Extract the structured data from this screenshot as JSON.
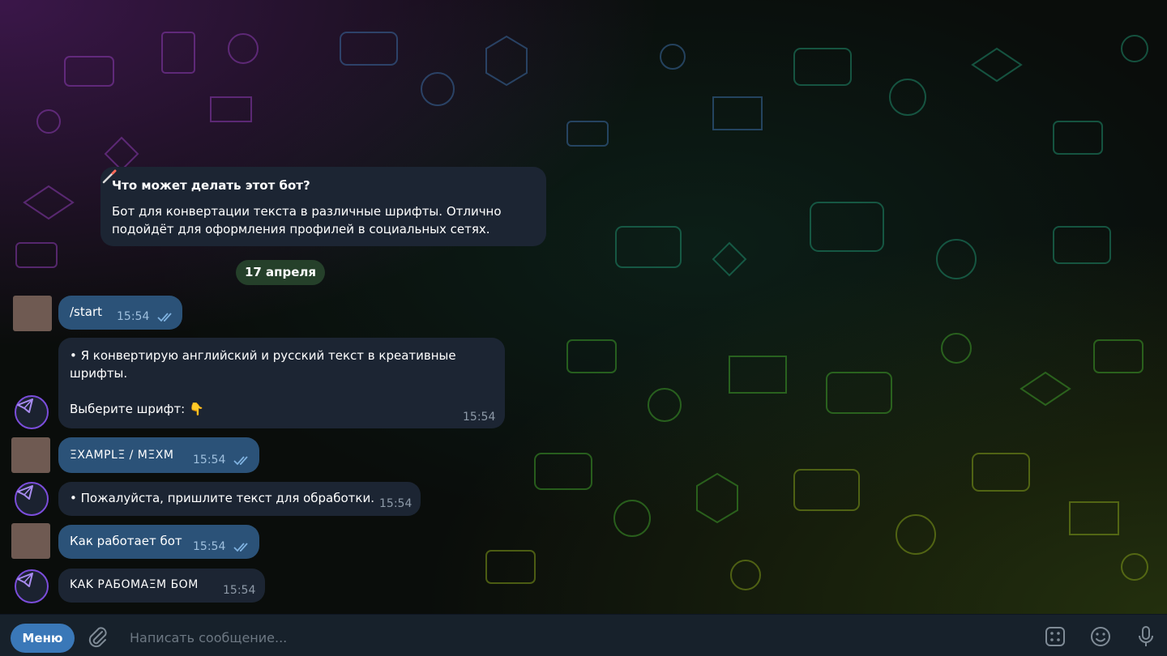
{
  "intro": {
    "title": "Что может делать этот бот?",
    "icon": "magic-wand-icon",
    "text": "Бот для конвертации текста в различные шрифты. Отлично подойдёт для оформления профилей в социальных сетях."
  },
  "date_separator": "17 апреля",
  "messages": [
    {
      "direction": "out",
      "text": "/start",
      "time": "15:54",
      "read": true
    },
    {
      "direction": "in",
      "text": "• Я конвертирую английский и русский текст в креативные шрифты.\n\nВыберите шрифт: 👇",
      "time": "15:54"
    },
    {
      "direction": "out",
      "text": "ΞΧΑΜΡLΞ / ΜΞΧΜ",
      "time": "15:54",
      "read": true
    },
    {
      "direction": "in",
      "text": "• Пожалуйста, пришлите текст для обработки.",
      "time": "15:54"
    },
    {
      "direction": "out",
      "text": "Как работает бот",
      "time": "15:54",
      "read": true
    },
    {
      "direction": "in",
      "text": "ΚΑΚ ΡΑБΟΜΑΞΜ БΟΜ",
      "time": "15:54"
    }
  ],
  "composer": {
    "menu_label": "Меню",
    "placeholder": "Написать сообщение...",
    "icons": [
      "paperclip-icon",
      "bot-commands-icon",
      "emoji-icon",
      "microphone-icon"
    ]
  },
  "colors": {
    "incoming_bubble": "#1c2533",
    "outgoing_bubble": "#2b5278",
    "date_pill": "#25402a",
    "menu_button": "#3a78b8",
    "composer": "#17212b"
  }
}
